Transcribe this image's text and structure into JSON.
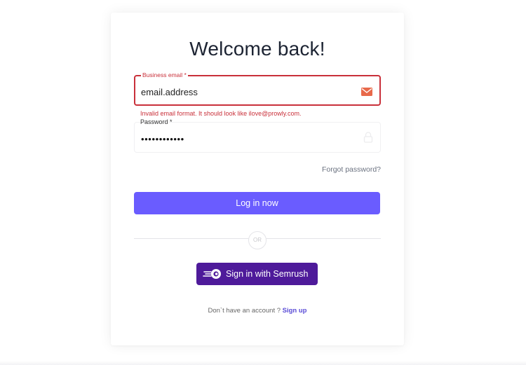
{
  "login": {
    "title": "Welcome back!",
    "email": {
      "label": "Business email *",
      "value": "email.address",
      "icon": "mail-icon",
      "error": "Invalid email format. It should look like ilove@prowly.com."
    },
    "password": {
      "label": "Password *",
      "value": "••••••••••••",
      "icon": "lock-icon"
    },
    "forgot_label": "Forgot password?",
    "login_button": "Log in now",
    "divider_text": "OR",
    "semrush_button": "Sign in with Semrush",
    "signup_prompt": "Don`t have an account ?",
    "signup_link": "Sign up"
  },
  "colors": {
    "error": "#c9303a",
    "primary": "#6a5cff",
    "semrush": "#4e1a9a",
    "mail_icon": "#e8694a"
  }
}
